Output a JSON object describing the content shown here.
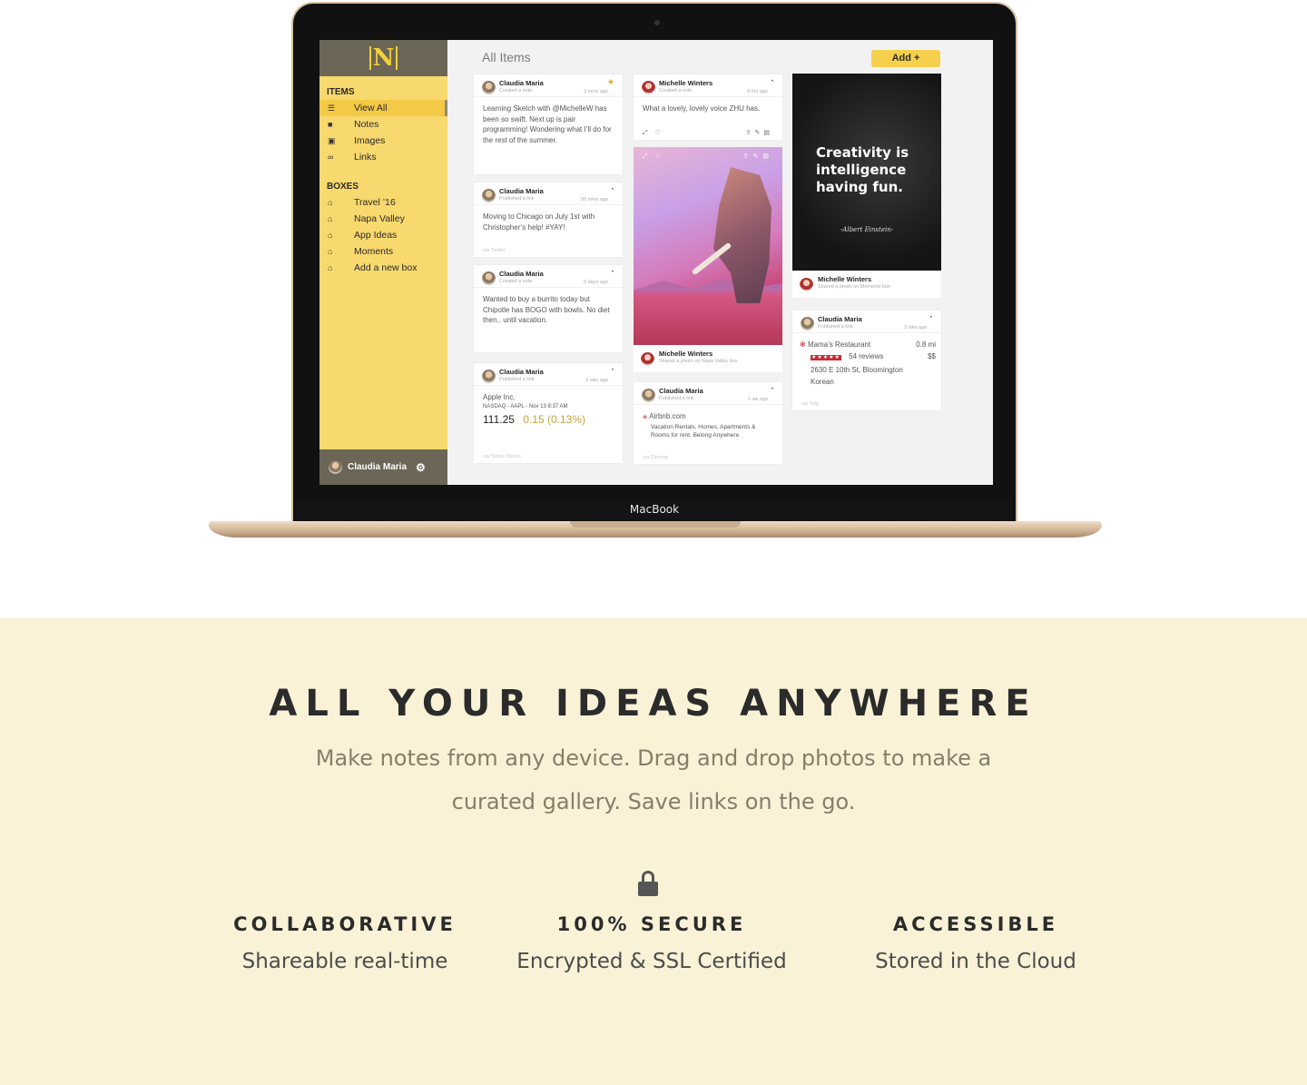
{
  "device": {
    "label": "MacBook"
  },
  "app": {
    "logo": "N",
    "main_title": "All Items",
    "add_button": "Add +",
    "sidebar": {
      "items_heading": "ITEMS",
      "items": [
        {
          "label": "View All",
          "icon": "list-icon"
        },
        {
          "label": "Notes",
          "icon": "note-icon"
        },
        {
          "label": "Images",
          "icon": "image-icon"
        },
        {
          "label": "Links",
          "icon": "link-icon"
        }
      ],
      "boxes_heading": "BOXES",
      "boxes": [
        {
          "label": "Travel ’16",
          "icon": "inbox-icon"
        },
        {
          "label": "Napa Valley",
          "icon": "inbox-icon"
        },
        {
          "label": "App Ideas",
          "icon": "inbox-icon"
        },
        {
          "label": "Moments",
          "icon": "inbox-icon"
        },
        {
          "label": "Add a new box",
          "icon": "inbox-icon"
        }
      ],
      "user": "Claudia Maria"
    },
    "cards": {
      "c1": {
        "name": "Claudia Maria",
        "sub": "Created a note",
        "time": "3 mins ago",
        "body": "Learning Sketch with @MichelleW has been so swift. Next up is pair programming! Wondering what I’ll do for the rest of the summer."
      },
      "c2": {
        "name": "Claudia Maria",
        "sub": "Published a link",
        "time": "50 mins ago",
        "body": "Moving to Chicago on July 1st with Christopher’s help! #YAY!",
        "via": "via Twitter"
      },
      "c3": {
        "name": "Claudia Maria",
        "sub": "Created a note",
        "time": "5 days ago",
        "body": "Wanted to buy a burrito today but Chipotle has BOGO with bowls. No diet then.. until vacation."
      },
      "c4": {
        "name": "Claudia Maria",
        "sub": "Published a link",
        "time": "2 wks ago",
        "company": "Apple Inc.",
        "ticker": "NASDAQ - AAPL - Nov 13 8:37 AM",
        "price": "111.25",
        "change": "0.15 (0.13%)",
        "via": "via Yahoo Stocks"
      },
      "c5": {
        "name": "Michelle Winters",
        "sub": "Created a note",
        "time": "9 hrs ago",
        "body": "What a lovely, lovely voice ZHU has."
      },
      "c6": {
        "name": "Michelle Winters",
        "sub": "Shared a photo on Napa Valley box"
      },
      "c7": {
        "name": "Claudia Maria",
        "sub": "Published a link",
        "time": "1 wk ago",
        "site": "Airbnb.com",
        "desc": "Vacation Rentals, Homes, Apartments & Rooms for rent. Belong Anywhere",
        "via": "via Chrome"
      },
      "c8": {
        "quote": "Creativity is intelligence having fun.",
        "author": "-Albert Einstein-",
        "name": "Michelle Winters",
        "sub": "Shared a photo on Moments box"
      },
      "c9": {
        "name": "Claudia Maria",
        "sub": "Published a link",
        "time": "2 wks ago",
        "place": "Mama’s Restaurant",
        "distance": "0.8 mi",
        "reviews": "54 reviews",
        "price_level": "$$",
        "address": "2630 E 10th St, Bloomington",
        "cuisine": "Korean",
        "via": "via Yelp",
        "stars": 5
      }
    }
  },
  "hero": {
    "headline": "ALL YOUR IDEAS ANYWHERE",
    "subline": "Make notes from any device. Drag and drop photos to make a curated gallery. Save links on the go."
  },
  "features": [
    {
      "title": "COLLABORATIVE",
      "text": "Shareable real-time"
    },
    {
      "title": "100% SECURE",
      "text": "Encrypted & SSL Certified",
      "icon": "lock-icon"
    },
    {
      "title": "ACCESSIBLE",
      "text": "Stored in the Cloud"
    }
  ],
  "colors": {
    "accent": "#f8d96e",
    "sidebar_dark": "#6b6656",
    "lower_bg": "#faf2d7"
  }
}
